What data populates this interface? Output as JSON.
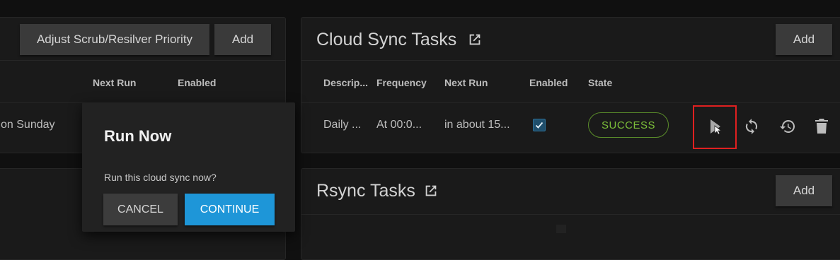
{
  "left_panel": {
    "buttons": {
      "adjust_priority": "Adjust Scrub/Resilver Priority",
      "add": "Add"
    },
    "columns": {
      "next_run": "Next Run",
      "enabled": "Enabled"
    },
    "row_partial_text": "on Sunday"
  },
  "dialog": {
    "title": "Run Now",
    "message": "Run this cloud sync now?",
    "cancel_label": "CANCEL",
    "continue_label": "CONTINUE"
  },
  "cloud_sync": {
    "title": "Cloud Sync Tasks",
    "add_label": "Add",
    "columns": {
      "description": "Descrip...",
      "frequency": "Frequency",
      "next_run": "Next Run",
      "enabled": "Enabled",
      "state": "State"
    },
    "row": {
      "description": "Daily ...",
      "frequency": "At 00:0...",
      "next_run": "in about 15...",
      "enabled": true,
      "state": "SUCCESS"
    },
    "actions": [
      "run-now-icon",
      "sync-icon",
      "restore-icon",
      "delete-icon"
    ]
  },
  "rsync": {
    "title": "Rsync Tasks",
    "add_label": "Add"
  },
  "colors": {
    "accent": "#1e96d8",
    "success": "#7cbf3a",
    "highlight": "#e02020"
  }
}
